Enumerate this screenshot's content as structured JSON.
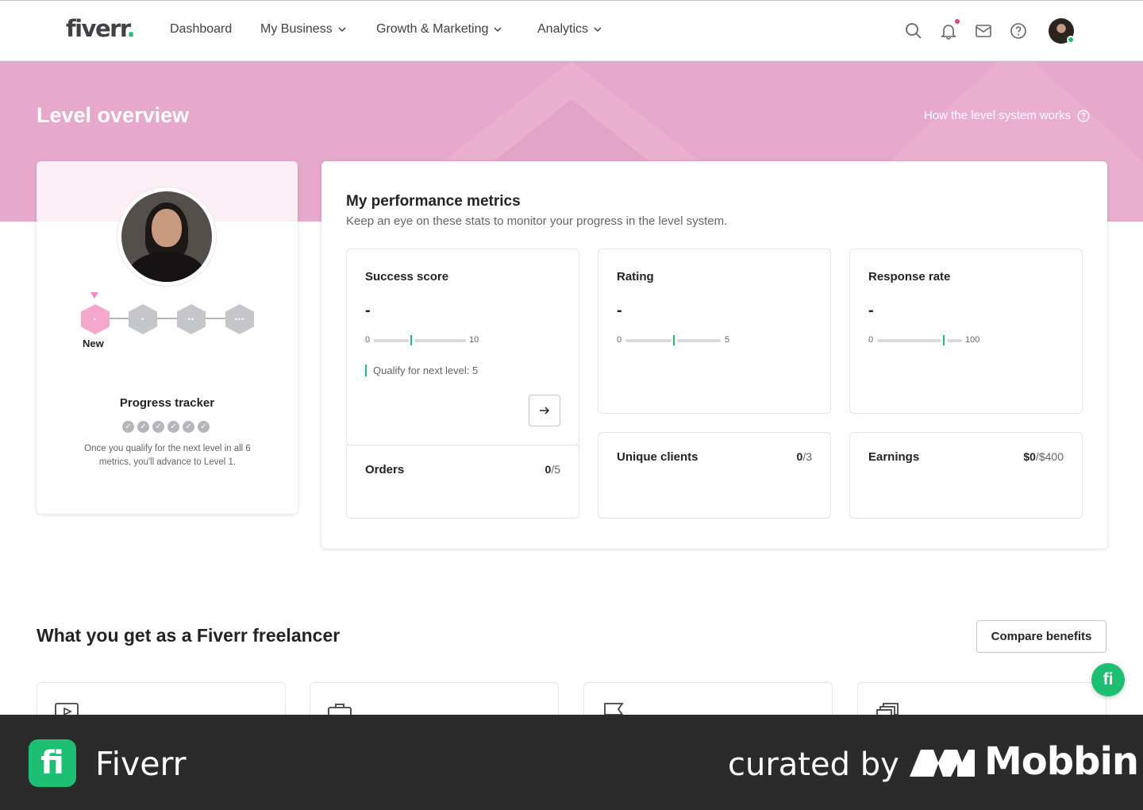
{
  "nav": {
    "logo": "fiverr",
    "logo_dot": ".",
    "items": [
      {
        "label": "Dashboard",
        "has_chevron": false
      },
      {
        "label": "My Business",
        "has_chevron": true
      },
      {
        "label": "Growth & Marketing",
        "has_chevron": true
      },
      {
        "label": "Analytics",
        "has_chevron": true
      }
    ],
    "icons": [
      "search-icon",
      "bell-icon",
      "mail-icon",
      "help-icon"
    ]
  },
  "hero": {
    "title": "Level overview",
    "help_link": "How the level system works"
  },
  "profile": {
    "level_label": "New",
    "level_badges": [
      "•",
      "•",
      "••",
      "•••"
    ],
    "progress_title": "Progress tracker",
    "progress_checks": 6,
    "progress_text": "Once you qualify for the next level in all 6 metrics, you'll advance to Level 1."
  },
  "metrics": {
    "title": "My performance metrics",
    "subtitle": "Keep an eye on these stats to monitor your progress in the level system.",
    "success": {
      "label": "Success score",
      "value": "-",
      "min": "0",
      "max": "10",
      "qualify": "Qualify for next level: 5"
    },
    "rating": {
      "label": "Rating",
      "value": "-",
      "min": "0",
      "max": "5"
    },
    "response": {
      "label": "Response rate",
      "value": "-",
      "min": "0",
      "max": "100"
    },
    "orders": {
      "label": "Orders",
      "current": "0",
      "target": "/5"
    },
    "clients": {
      "label": "Unique clients",
      "current": "0",
      "target": "/3"
    },
    "earnings": {
      "label": "Earnings",
      "current": "$0",
      "target": "/$400"
    }
  },
  "benefits": {
    "title": "What you get as a Fiverr freelancer",
    "compare_label": "Compare benefits",
    "card_icons": [
      "video-icon",
      "briefcase-icon",
      "flag-icon",
      "stack-icon"
    ]
  },
  "fab_label": "fi",
  "footer": {
    "app_icon": "fi",
    "app_name": "Fiverr",
    "curated": "curated by",
    "brand": "Mobbin"
  },
  "colors": {
    "brand_green": "#1dbf73",
    "hero_pink": "#e6a9cb",
    "level_pink": "#f3a7cd",
    "footer_bg": "#2b2b2b"
  }
}
